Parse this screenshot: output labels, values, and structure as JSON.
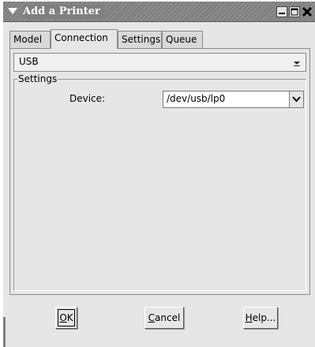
{
  "window": {
    "title": "Add a Printer"
  },
  "icons": {
    "window_menu": "chevron-down-icon",
    "minimize": "minimize-icon",
    "maximize": "maximize-icon",
    "close": "close-icon"
  },
  "tabs": [
    {
      "label": "Model",
      "active": false
    },
    {
      "label": "Connection",
      "active": true
    },
    {
      "label": "Settings",
      "active": false
    },
    {
      "label": "Queue",
      "active": false
    }
  ],
  "connection": {
    "type_value": "USB",
    "group_label": "Settings",
    "device_label": "Device:",
    "device_value": "/dev/usb/lp0"
  },
  "buttons": {
    "ok": {
      "mnemonic": "O",
      "rest": "K"
    },
    "cancel": {
      "mnemonic": "C",
      "rest": "ancel"
    },
    "help": {
      "mnemonic": "H",
      "rest": "elp..."
    }
  },
  "colors": {
    "titlebar": "#7f7f7f",
    "window_bg": "#e6e6e6"
  }
}
